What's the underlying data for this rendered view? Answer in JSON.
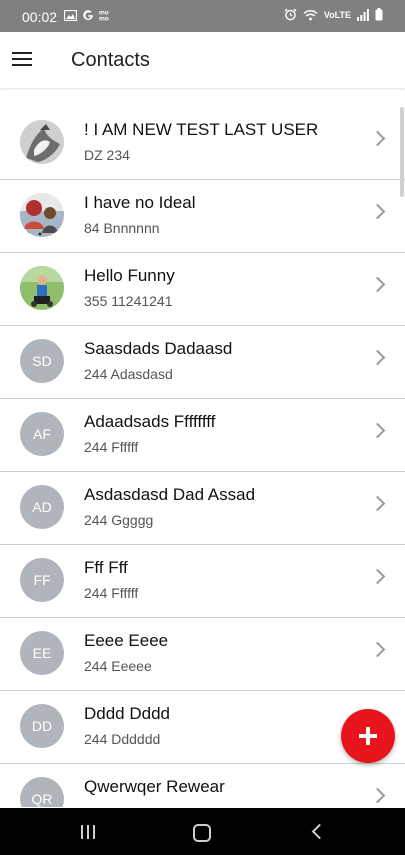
{
  "status_bar": {
    "time": "00:02",
    "left_icons": [
      "image-icon",
      "google-icon",
      "mo-icon"
    ],
    "right_icons": [
      "alarm-icon",
      "wifi-icon",
      "volte-icon",
      "signal-icon",
      "battery-icon"
    ],
    "volte_text": "VoLTE"
  },
  "header": {
    "title": "Contacts",
    "menu_icon": "menu-icon"
  },
  "contacts": [
    {
      "name": "! I AM NEW TEST LAST USER",
      "sub": "DZ 234",
      "initials": "",
      "photo": true
    },
    {
      "name": "I have no Ideal",
      "sub": "84 Bnnnnnn",
      "initials": "",
      "photo": true
    },
    {
      "name": "Hello Funny",
      "sub": "355 11241241",
      "initials": "",
      "photo": true
    },
    {
      "name": "Saasdads Dadaasd",
      "sub": "244 Adasdasd",
      "initials": "SD",
      "photo": false
    },
    {
      "name": "Adaadsads Ffffffff",
      "sub": "244 Ffffff",
      "initials": "AF",
      "photo": false
    },
    {
      "name": "Asdasdasd Dad Assad",
      "sub": "244 Ggggg",
      "initials": "AD",
      "photo": false
    },
    {
      "name": "Fff Fff",
      "sub": "244 Ffffff",
      "initials": "FF",
      "photo": false
    },
    {
      "name": "Eeee Eeee",
      "sub": "244 Eeeee",
      "initials": "EE",
      "photo": false
    },
    {
      "name": "Dddd Dddd",
      "sub": "244 Dddddd",
      "initials": "DD",
      "photo": false
    },
    {
      "name": "Qwerwqer Rewear",
      "sub": "",
      "initials": "QR",
      "photo": false
    }
  ],
  "fab": {
    "icon": "plus-icon",
    "color": "#e8141b"
  },
  "nav_bar": {
    "icons": [
      "recents-icon",
      "home-icon",
      "back-icon"
    ]
  }
}
